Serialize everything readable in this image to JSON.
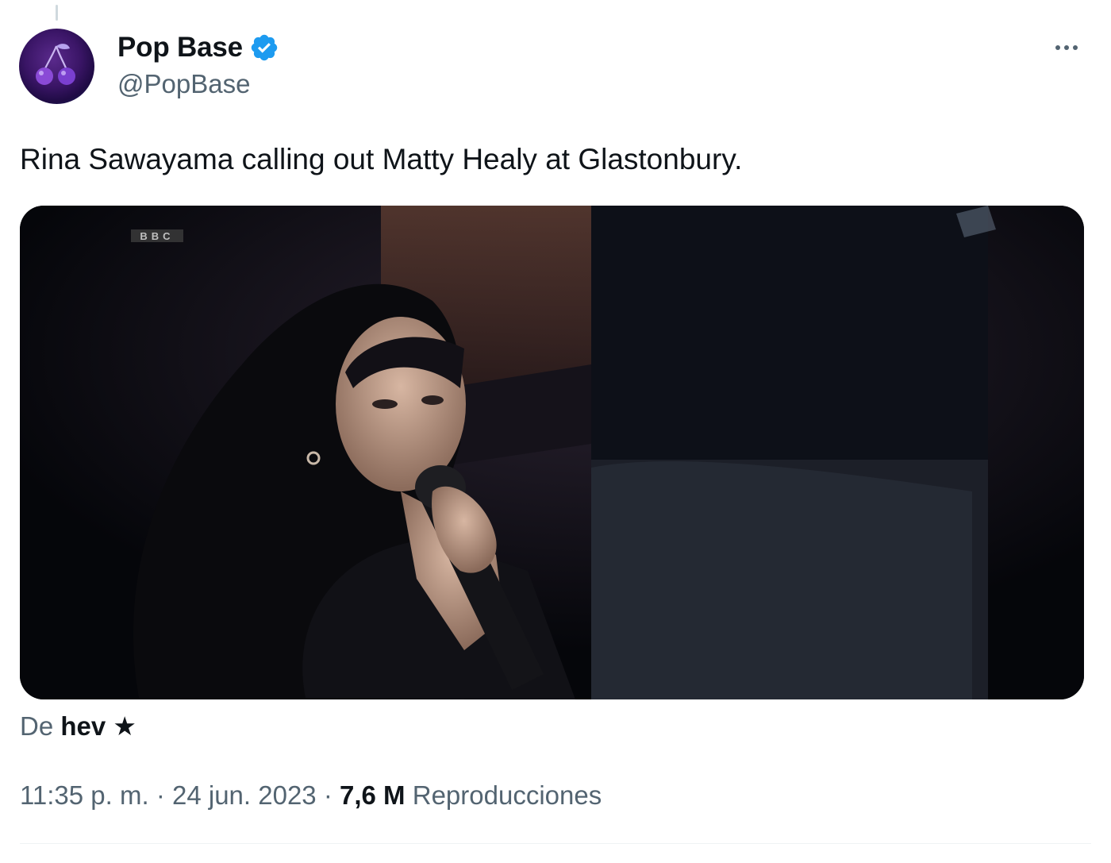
{
  "author": {
    "display_name": "Pop Base",
    "handle": "@PopBase",
    "avatar_icon": "cherries-icon",
    "verified": true,
    "verified_color": "#1d9bf0"
  },
  "tweet": {
    "text": "Rina Sawayama calling out Matty Healy at Glastonbury.",
    "media": {
      "type": "video",
      "watermark": "BBC"
    },
    "attribution": {
      "prefix": "De",
      "source_name": "hev",
      "source_emoji": "★"
    },
    "meta": {
      "time": "11:35 p. m.",
      "separator": "·",
      "date": "24 jun. 2023",
      "views_count": "7,6 M",
      "views_label": "Reproducciones"
    }
  },
  "colors": {
    "text_primary": "#0f1419",
    "text_secondary": "#536471",
    "divider": "#eff3f4"
  }
}
